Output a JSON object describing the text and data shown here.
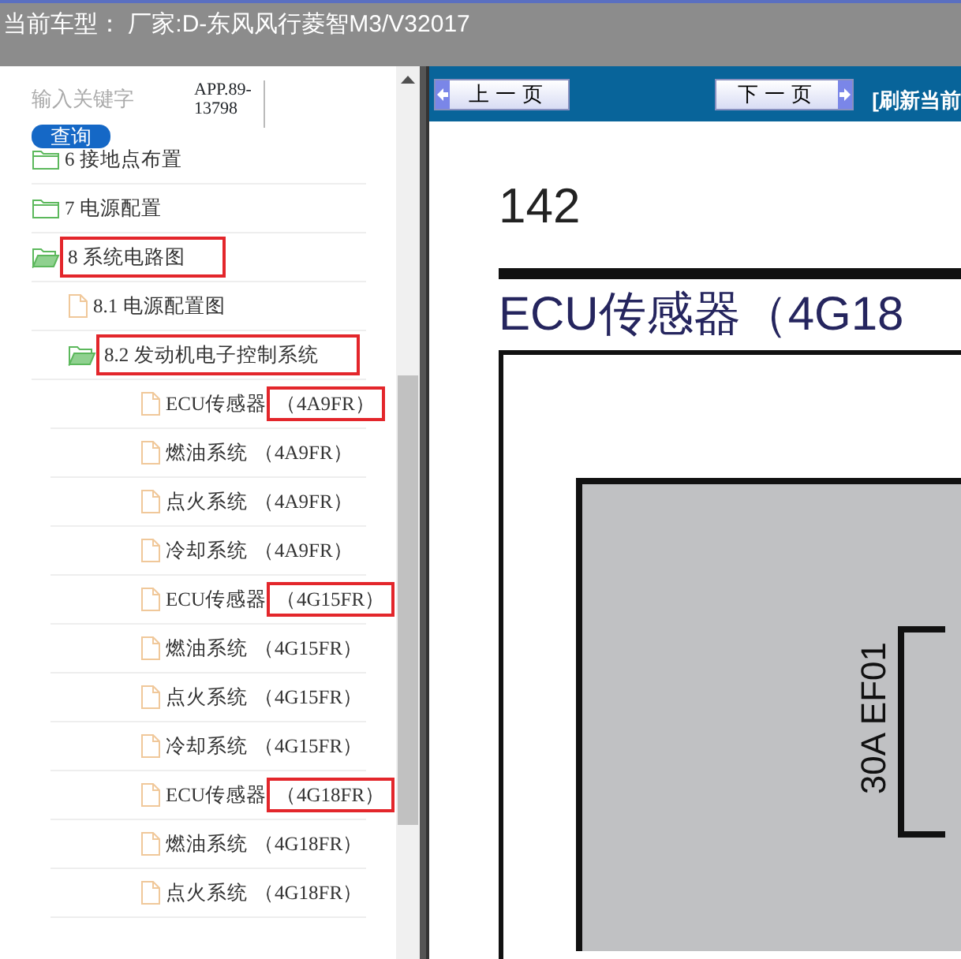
{
  "header": {
    "title": "当前车型： 厂家:D-东风风行菱智M3/V32017"
  },
  "search": {
    "placeholder": "输入关键字",
    "button": "查询",
    "app_code": "APP.89-13798"
  },
  "tree": [
    {
      "kind": "folder",
      "label": "6 接地点布置",
      "expanded": false,
      "annotated": false
    },
    {
      "kind": "folder",
      "label": "7 电源配置",
      "expanded": false,
      "annotated": false
    },
    {
      "kind": "folder",
      "label": "8 系统电路图",
      "expanded": true,
      "annotated": true,
      "children": [
        {
          "kind": "file",
          "label": "8.1 电源配置图",
          "annotated": false
        },
        {
          "kind": "folder",
          "label": "8.2 发动机电子控制系统",
          "expanded": true,
          "annotated": true,
          "children": [
            {
              "kind": "file",
              "label": "ECU传感器",
              "code": "（4A9FR）",
              "annotated": true
            },
            {
              "kind": "file",
              "label": "燃油系统",
              "code": "（4A9FR）",
              "annotated": false
            },
            {
              "kind": "file",
              "label": "点火系统",
              "code": "（4A9FR）",
              "annotated": false
            },
            {
              "kind": "file",
              "label": "冷却系统",
              "code": "（4A9FR）",
              "annotated": false
            },
            {
              "kind": "file",
              "label": "ECU传感器",
              "code": "（4G15FR）",
              "annotated": true
            },
            {
              "kind": "file",
              "label": "燃油系统",
              "code": "（4G15FR）",
              "annotated": false
            },
            {
              "kind": "file",
              "label": "点火系统",
              "code": "（4G15FR）",
              "annotated": false
            },
            {
              "kind": "file",
              "label": "冷却系统",
              "code": "（4G15FR）",
              "annotated": false
            },
            {
              "kind": "file",
              "label": "ECU传感器",
              "code": "（4G18FR）",
              "annotated": true
            },
            {
              "kind": "file",
              "label": "燃油系统",
              "code": "（4G18FR）",
              "annotated": false
            },
            {
              "kind": "file",
              "label": "点火系统",
              "code": "（4G18FR）",
              "annotated": false
            }
          ]
        }
      ]
    }
  ],
  "toolbar": {
    "prev": "上一页",
    "next": "下一页",
    "refresh": "[刷新当前"
  },
  "document": {
    "page_number": "142",
    "title": "ECU传感器（4G18",
    "fuse_label": "30A EF01"
  }
}
